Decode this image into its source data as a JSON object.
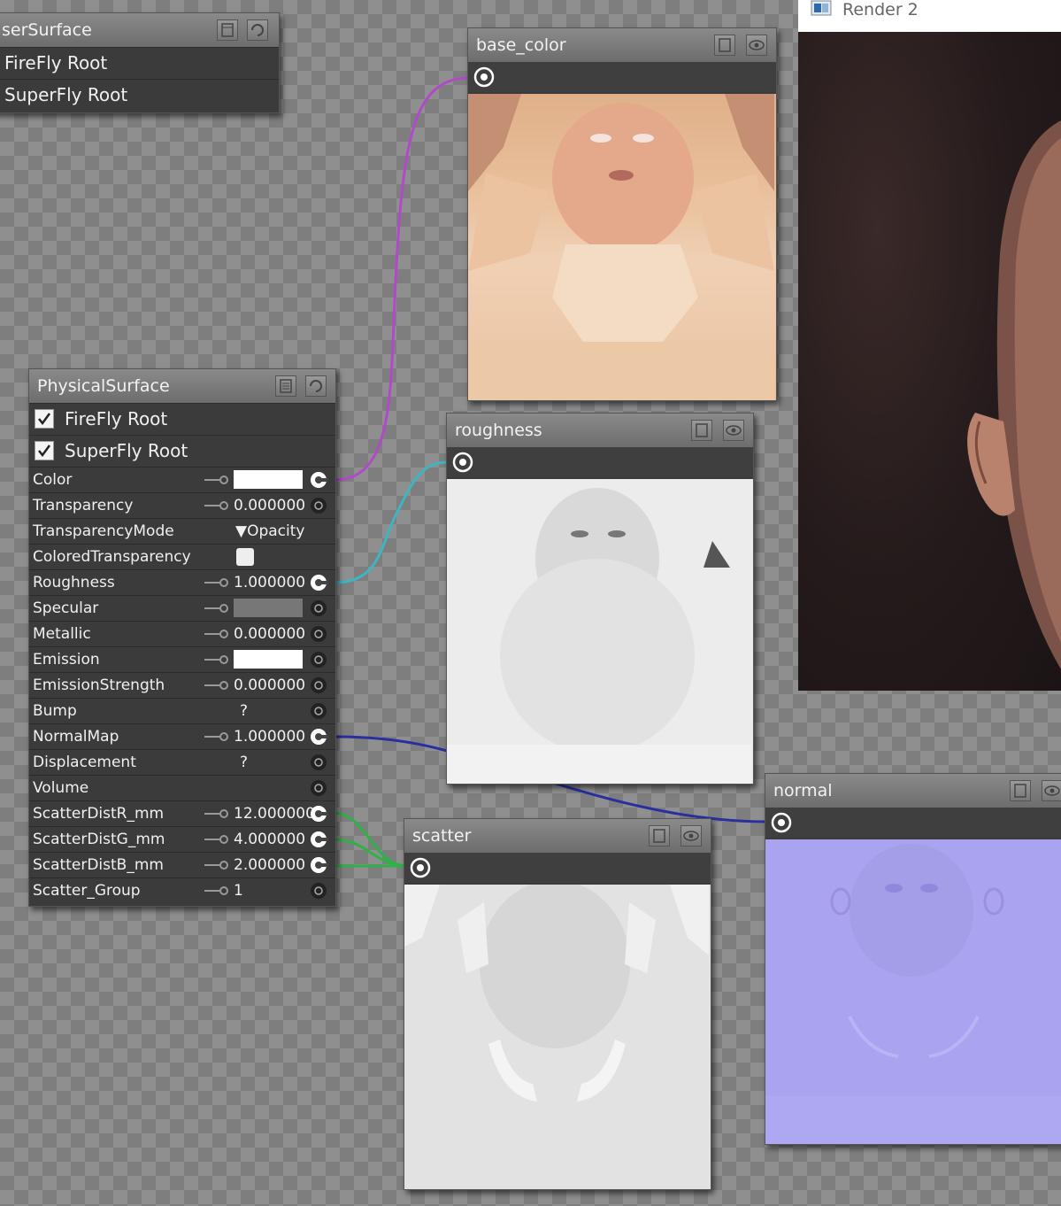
{
  "user_surface": {
    "title": "serSurface",
    "rows": [
      "FireFly Root",
      "SuperFly Root"
    ]
  },
  "physical_surface": {
    "title": "PhysicalSurface",
    "roots": [
      {
        "label": "FireFly Root",
        "checked": true
      },
      {
        "label": "SuperFly Root",
        "checked": true
      }
    ],
    "params": [
      {
        "label": "Color",
        "value": "",
        "widget": "swatch-white",
        "connected": true
      },
      {
        "label": "Transparency",
        "value": "0.000000",
        "widget": "number",
        "connected": false
      },
      {
        "label": "TransparencyMode",
        "value": "▼Opacity",
        "widget": "dropdown",
        "connected": false
      },
      {
        "label": "ColoredTransparency",
        "value": "",
        "widget": "checkbox",
        "connected": false
      },
      {
        "label": "Roughness",
        "value": "1.000000",
        "widget": "number",
        "connected": true
      },
      {
        "label": "Specular",
        "value": "",
        "widget": "swatch-gray",
        "connected": false
      },
      {
        "label": "Metallic",
        "value": "0.000000",
        "widget": "number",
        "connected": false
      },
      {
        "label": "Emission",
        "value": "",
        "widget": "swatch-white",
        "connected": false
      },
      {
        "label": "EmissionStrength",
        "value": "0.000000",
        "widget": "number",
        "connected": false
      },
      {
        "label": "Bump",
        "value": "?",
        "widget": "unknown",
        "connected": false
      },
      {
        "label": "NormalMap",
        "value": "1.000000",
        "widget": "number",
        "connected": true
      },
      {
        "label": "Displacement",
        "value": "?",
        "widget": "unknown",
        "connected": false
      },
      {
        "label": "Volume",
        "value": "",
        "widget": "none",
        "connected": false
      },
      {
        "label": "ScatterDistR_mm",
        "value": "12.000000",
        "widget": "number",
        "connected": true
      },
      {
        "label": "ScatterDistG_mm",
        "value": "4.000000",
        "widget": "number",
        "connected": true
      },
      {
        "label": "ScatterDistB_mm",
        "value": "2.000000",
        "widget": "number",
        "connected": true
      },
      {
        "label": "Scatter_Group",
        "value": "1",
        "widget": "number",
        "connected": false
      }
    ]
  },
  "texture_nodes": {
    "base_color": {
      "title": "base_color"
    },
    "roughness": {
      "title": "roughness"
    },
    "scatter": {
      "title": "scatter"
    },
    "normal": {
      "title": "normal"
    }
  },
  "render_window": {
    "title": "Render 2"
  },
  "colors": {
    "base_color_link": "#b04ac8",
    "roughness_link": "#3cb6c0",
    "normal_link": "#2a2fa0",
    "scatter_link": "#2fb14a"
  }
}
